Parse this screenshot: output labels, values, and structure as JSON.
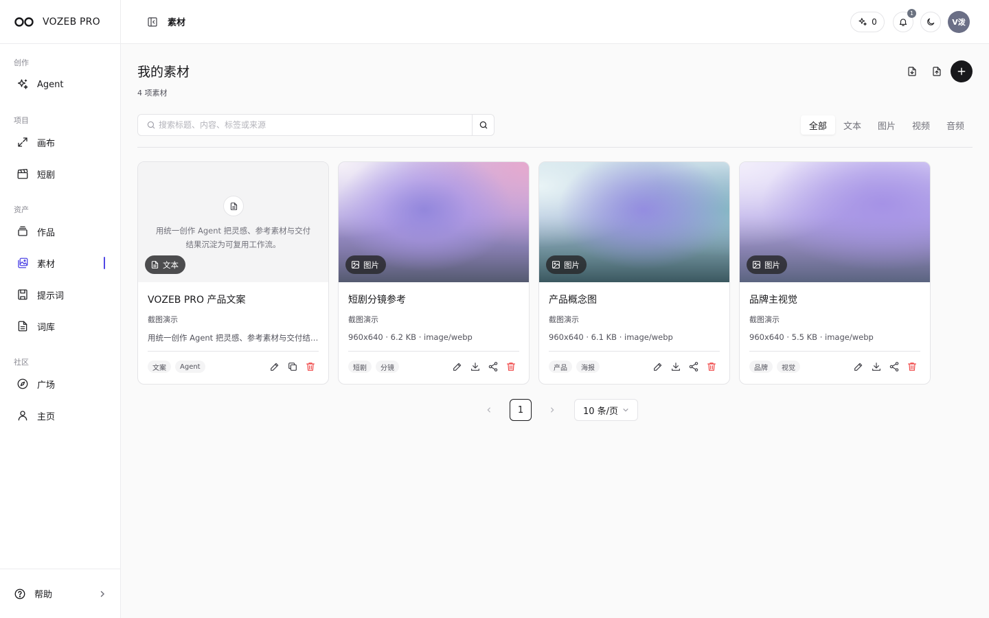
{
  "brand": {
    "name": "VOZEB PRO"
  },
  "sidebar": {
    "sections": [
      {
        "label": "创作",
        "items": [
          {
            "label": "Agent",
            "icon": "sparkles-icon"
          }
        ]
      },
      {
        "label": "项目",
        "items": [
          {
            "label": "画布",
            "icon": "expand-arrows-icon"
          },
          {
            "label": "短剧",
            "icon": "clapperboard-icon"
          }
        ]
      },
      {
        "label": "资产",
        "items": [
          {
            "label": "作品",
            "icon": "layers-icon"
          },
          {
            "label": "素材",
            "icon": "images-icon",
            "active": true
          },
          {
            "label": "提示词",
            "icon": "save-icon"
          },
          {
            "label": "词库",
            "icon": "file-text-icon"
          }
        ]
      },
      {
        "label": "社区",
        "items": [
          {
            "label": "广场",
            "icon": "compass-icon"
          },
          {
            "label": "主页",
            "icon": "user-icon"
          }
        ]
      }
    ],
    "help_label": "帮助"
  },
  "topbar": {
    "title": "素材",
    "credits": "0",
    "notification_count": "1",
    "avatar_text": "V泼"
  },
  "page": {
    "title": "我的素材",
    "subtitle": "4 项素材",
    "search_placeholder": "搜索标题、内容、标签或来源",
    "filters": [
      "全部",
      "文本",
      "图片",
      "视频",
      "音频"
    ],
    "active_filter": "全部"
  },
  "cards": [
    {
      "type": "text",
      "type_label": "文本",
      "preview": "用统一创作 Agent 把灵感、参考素材与交付结果沉淀为可复用工作流。",
      "title": "VOZEB PRO 产品文案",
      "source": "截图演示",
      "meta": "用统一创作 Agent 把灵感、参考素材与交付结果沉淀为可复用工作流。",
      "tags": [
        "文案",
        "Agent"
      ],
      "actions": [
        "edit",
        "copy",
        "delete"
      ]
    },
    {
      "type": "image",
      "type_label": "图片",
      "title": "短剧分镜参考",
      "source": "截图演示",
      "meta": "960x640 · 6.2 KB · image/webp",
      "tags": [
        "短剧",
        "分镜"
      ],
      "actions": [
        "edit",
        "download",
        "share",
        "delete"
      ],
      "gradient": [
        "#f3eef7",
        "#a996e8",
        "#e7a9cf",
        "#5a6073"
      ]
    },
    {
      "type": "image",
      "type_label": "图片",
      "title": "产品概念图",
      "source": "截图演示",
      "meta": "960x640 · 6.1 KB · image/webp",
      "tags": [
        "产品",
        "海报"
      ],
      "actions": [
        "edit",
        "download",
        "share",
        "delete"
      ],
      "gradient": [
        "#e3f1f5",
        "#9d96e0",
        "#7fb1c2",
        "#3f5b62"
      ]
    },
    {
      "type": "image",
      "type_label": "图片",
      "title": "品牌主视觉",
      "source": "截图演示",
      "meta": "960x640 · 5.5 KB · image/webp",
      "tags": [
        "品牌",
        "视觉"
      ],
      "actions": [
        "edit",
        "download",
        "share",
        "delete"
      ],
      "gradient": [
        "#efe9fb",
        "#b1a0ee",
        "#a995e6",
        "#5f6781"
      ]
    }
  ],
  "pagination": {
    "current": "1",
    "page_size": "10 条/页"
  },
  "colors": {
    "accent": "#4f46e5",
    "danger": "#ef4444"
  }
}
